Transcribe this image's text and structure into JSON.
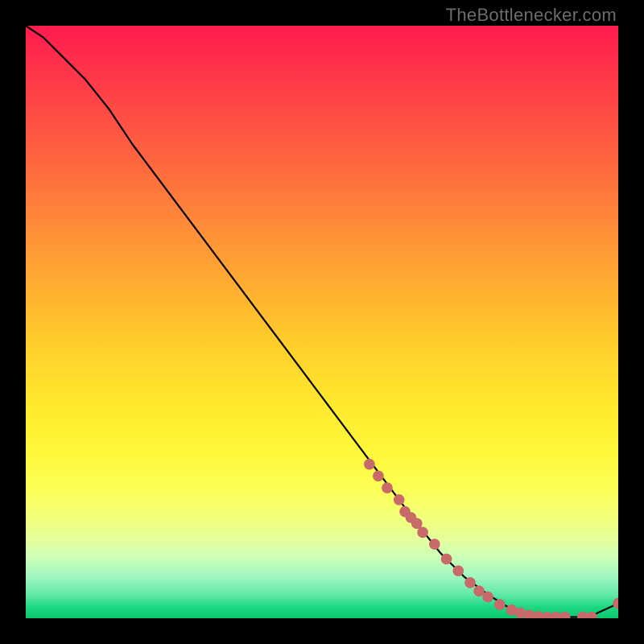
{
  "credit_text": "TheBottlenecker.com",
  "chart_data": {
    "type": "line",
    "title": "",
    "xlabel": "",
    "ylabel": "",
    "xlim": [
      0,
      100
    ],
    "ylim": [
      0,
      100
    ],
    "curve": {
      "name": "bottleneck-curve",
      "x": [
        0,
        3,
        6,
        10,
        14,
        18,
        24,
        30,
        36,
        42,
        48,
        54,
        60,
        66,
        70,
        74,
        78,
        82,
        86,
        90,
        95,
        100
      ],
      "y": [
        100,
        98,
        95,
        91,
        86,
        80,
        72,
        64,
        56,
        48,
        40,
        32,
        24,
        16,
        11,
        7,
        4,
        1.5,
        0.5,
        0.2,
        0.2,
        2.5
      ]
    },
    "scatter": {
      "name": "highlight-points",
      "points": [
        {
          "x": 58,
          "y": 26
        },
        {
          "x": 59.5,
          "y": 24
        },
        {
          "x": 61,
          "y": 22
        },
        {
          "x": 63,
          "y": 20
        },
        {
          "x": 64,
          "y": 18
        },
        {
          "x": 65,
          "y": 17
        },
        {
          "x": 66,
          "y": 16
        },
        {
          "x": 67,
          "y": 14.5
        },
        {
          "x": 69,
          "y": 12.5
        },
        {
          "x": 71,
          "y": 10
        },
        {
          "x": 73,
          "y": 8
        },
        {
          "x": 75,
          "y": 6
        },
        {
          "x": 76.5,
          "y": 4.6
        },
        {
          "x": 78,
          "y": 3.6
        },
        {
          "x": 80,
          "y": 2.3
        },
        {
          "x": 82,
          "y": 1.4
        },
        {
          "x": 83.5,
          "y": 0.9
        },
        {
          "x": 85,
          "y": 0.5
        },
        {
          "x": 86.5,
          "y": 0.3
        },
        {
          "x": 88,
          "y": 0.2
        },
        {
          "x": 89.5,
          "y": 0.2
        },
        {
          "x": 91,
          "y": 0.2
        },
        {
          "x": 94,
          "y": 0.2
        },
        {
          "x": 95.5,
          "y": 0.2
        },
        {
          "x": 100,
          "y": 2.5
        }
      ]
    }
  }
}
